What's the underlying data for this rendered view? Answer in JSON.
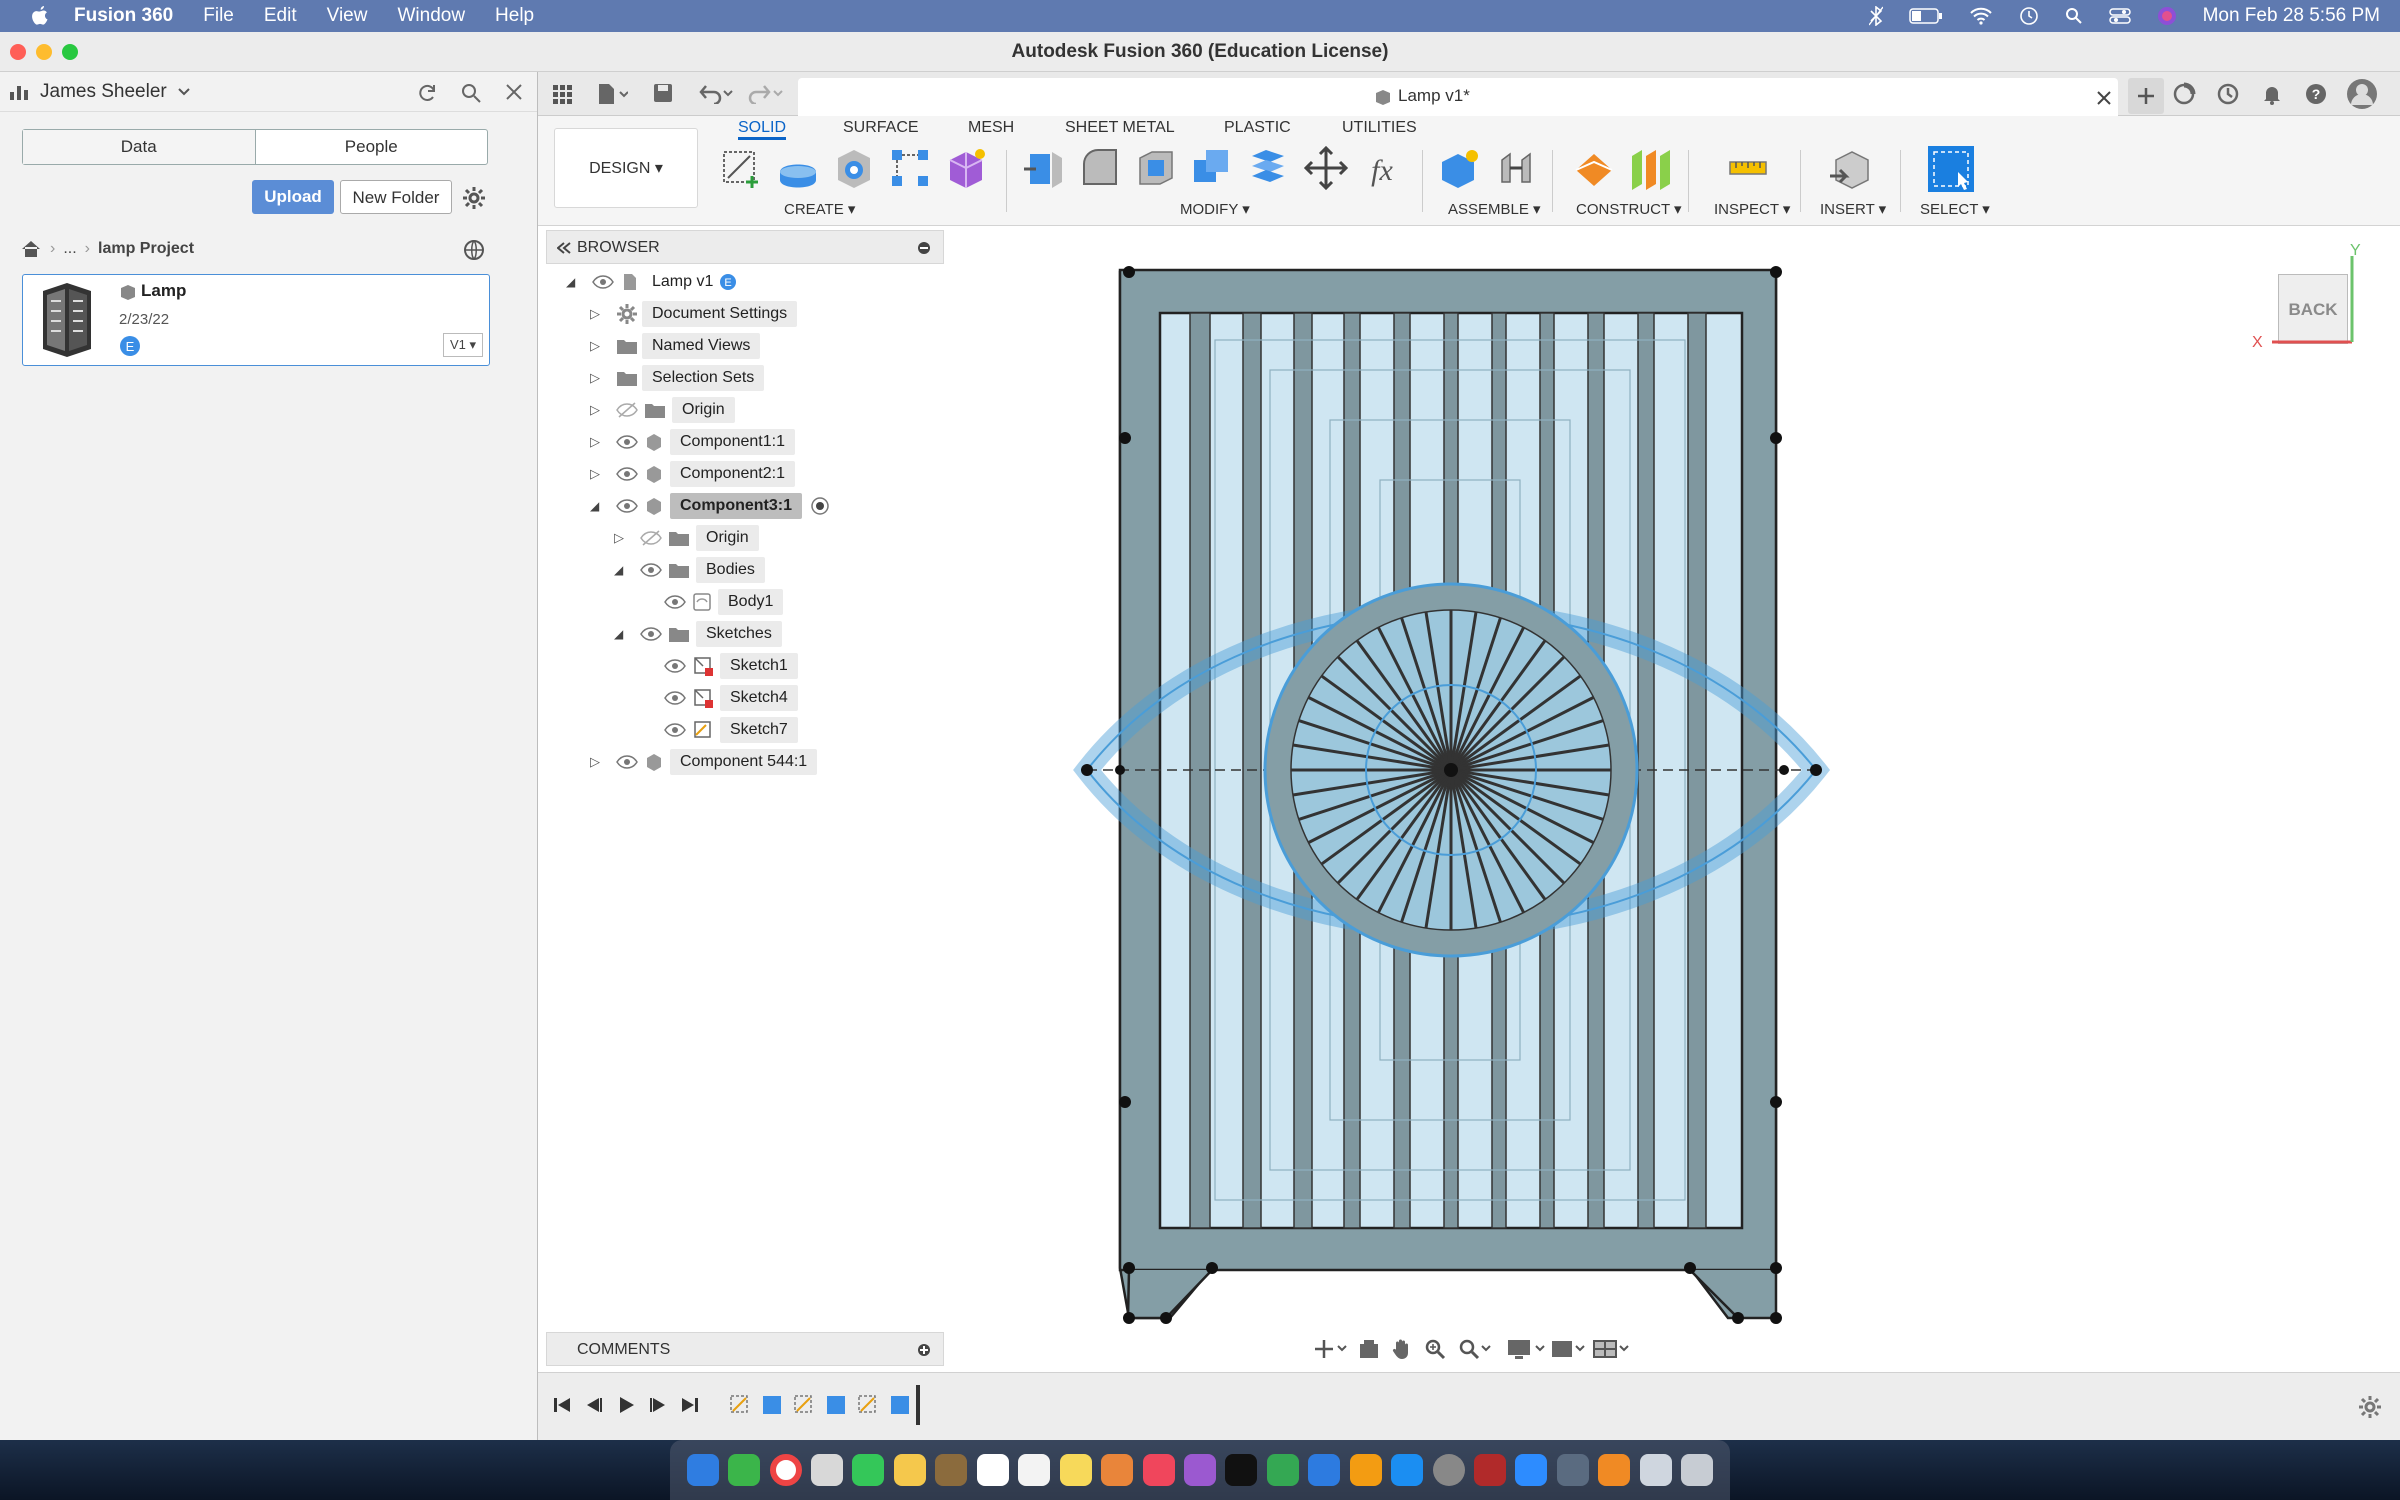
{
  "menubar": {
    "app": "Fusion 360",
    "items": [
      "File",
      "Edit",
      "View",
      "Window",
      "Help"
    ],
    "datetime": "Mon Feb 28  5:56 PM"
  },
  "window": {
    "title": "Autodesk Fusion 360 (Education License)"
  },
  "data_panel": {
    "user": "James Sheeler",
    "toggle": [
      "Data",
      "People"
    ],
    "upload": "Upload",
    "new_folder": "New Folder",
    "breadcrumb_more": "...",
    "project": "lamp Project",
    "file": {
      "name": "Lamp",
      "date": "2/23/22",
      "version": "V1"
    }
  },
  "doc_tab": {
    "title": "Lamp v1*"
  },
  "ribbon": {
    "workspace": "DESIGN",
    "tabs": [
      "SOLID",
      "SURFACE",
      "MESH",
      "SHEET METAL",
      "PLASTIC",
      "UTILITIES"
    ],
    "groups": [
      "CREATE",
      "MODIFY",
      "ASSEMBLE",
      "CONSTRUCT",
      "INSPECT",
      "INSERT",
      "SELECT"
    ]
  },
  "browser": {
    "title": "BROWSER",
    "root": "Lamp v1",
    "items": [
      {
        "label": "Document Settings"
      },
      {
        "label": "Named Views"
      },
      {
        "label": "Selection Sets"
      },
      {
        "label": "Origin"
      },
      {
        "label": "Component1:1"
      },
      {
        "label": "Component2:1"
      },
      {
        "label": "Component3:1"
      },
      {
        "label": "Origin"
      },
      {
        "label": "Bodies"
      },
      {
        "label": "Body1"
      },
      {
        "label": "Sketches"
      },
      {
        "label": "Sketch1"
      },
      {
        "label": "Sketch4"
      },
      {
        "label": "Sketch7"
      },
      {
        "label": "Component 544:1"
      }
    ]
  },
  "comments": {
    "title": "COMMENTS"
  },
  "viewcube": {
    "face": "BACK",
    "axis_x": "X",
    "axis_y": "Y"
  },
  "colors": {
    "accent": "#0a64c8",
    "upload": "#5b8dd6",
    "panel": "#849ea6",
    "glass": "#cfe6f2"
  }
}
